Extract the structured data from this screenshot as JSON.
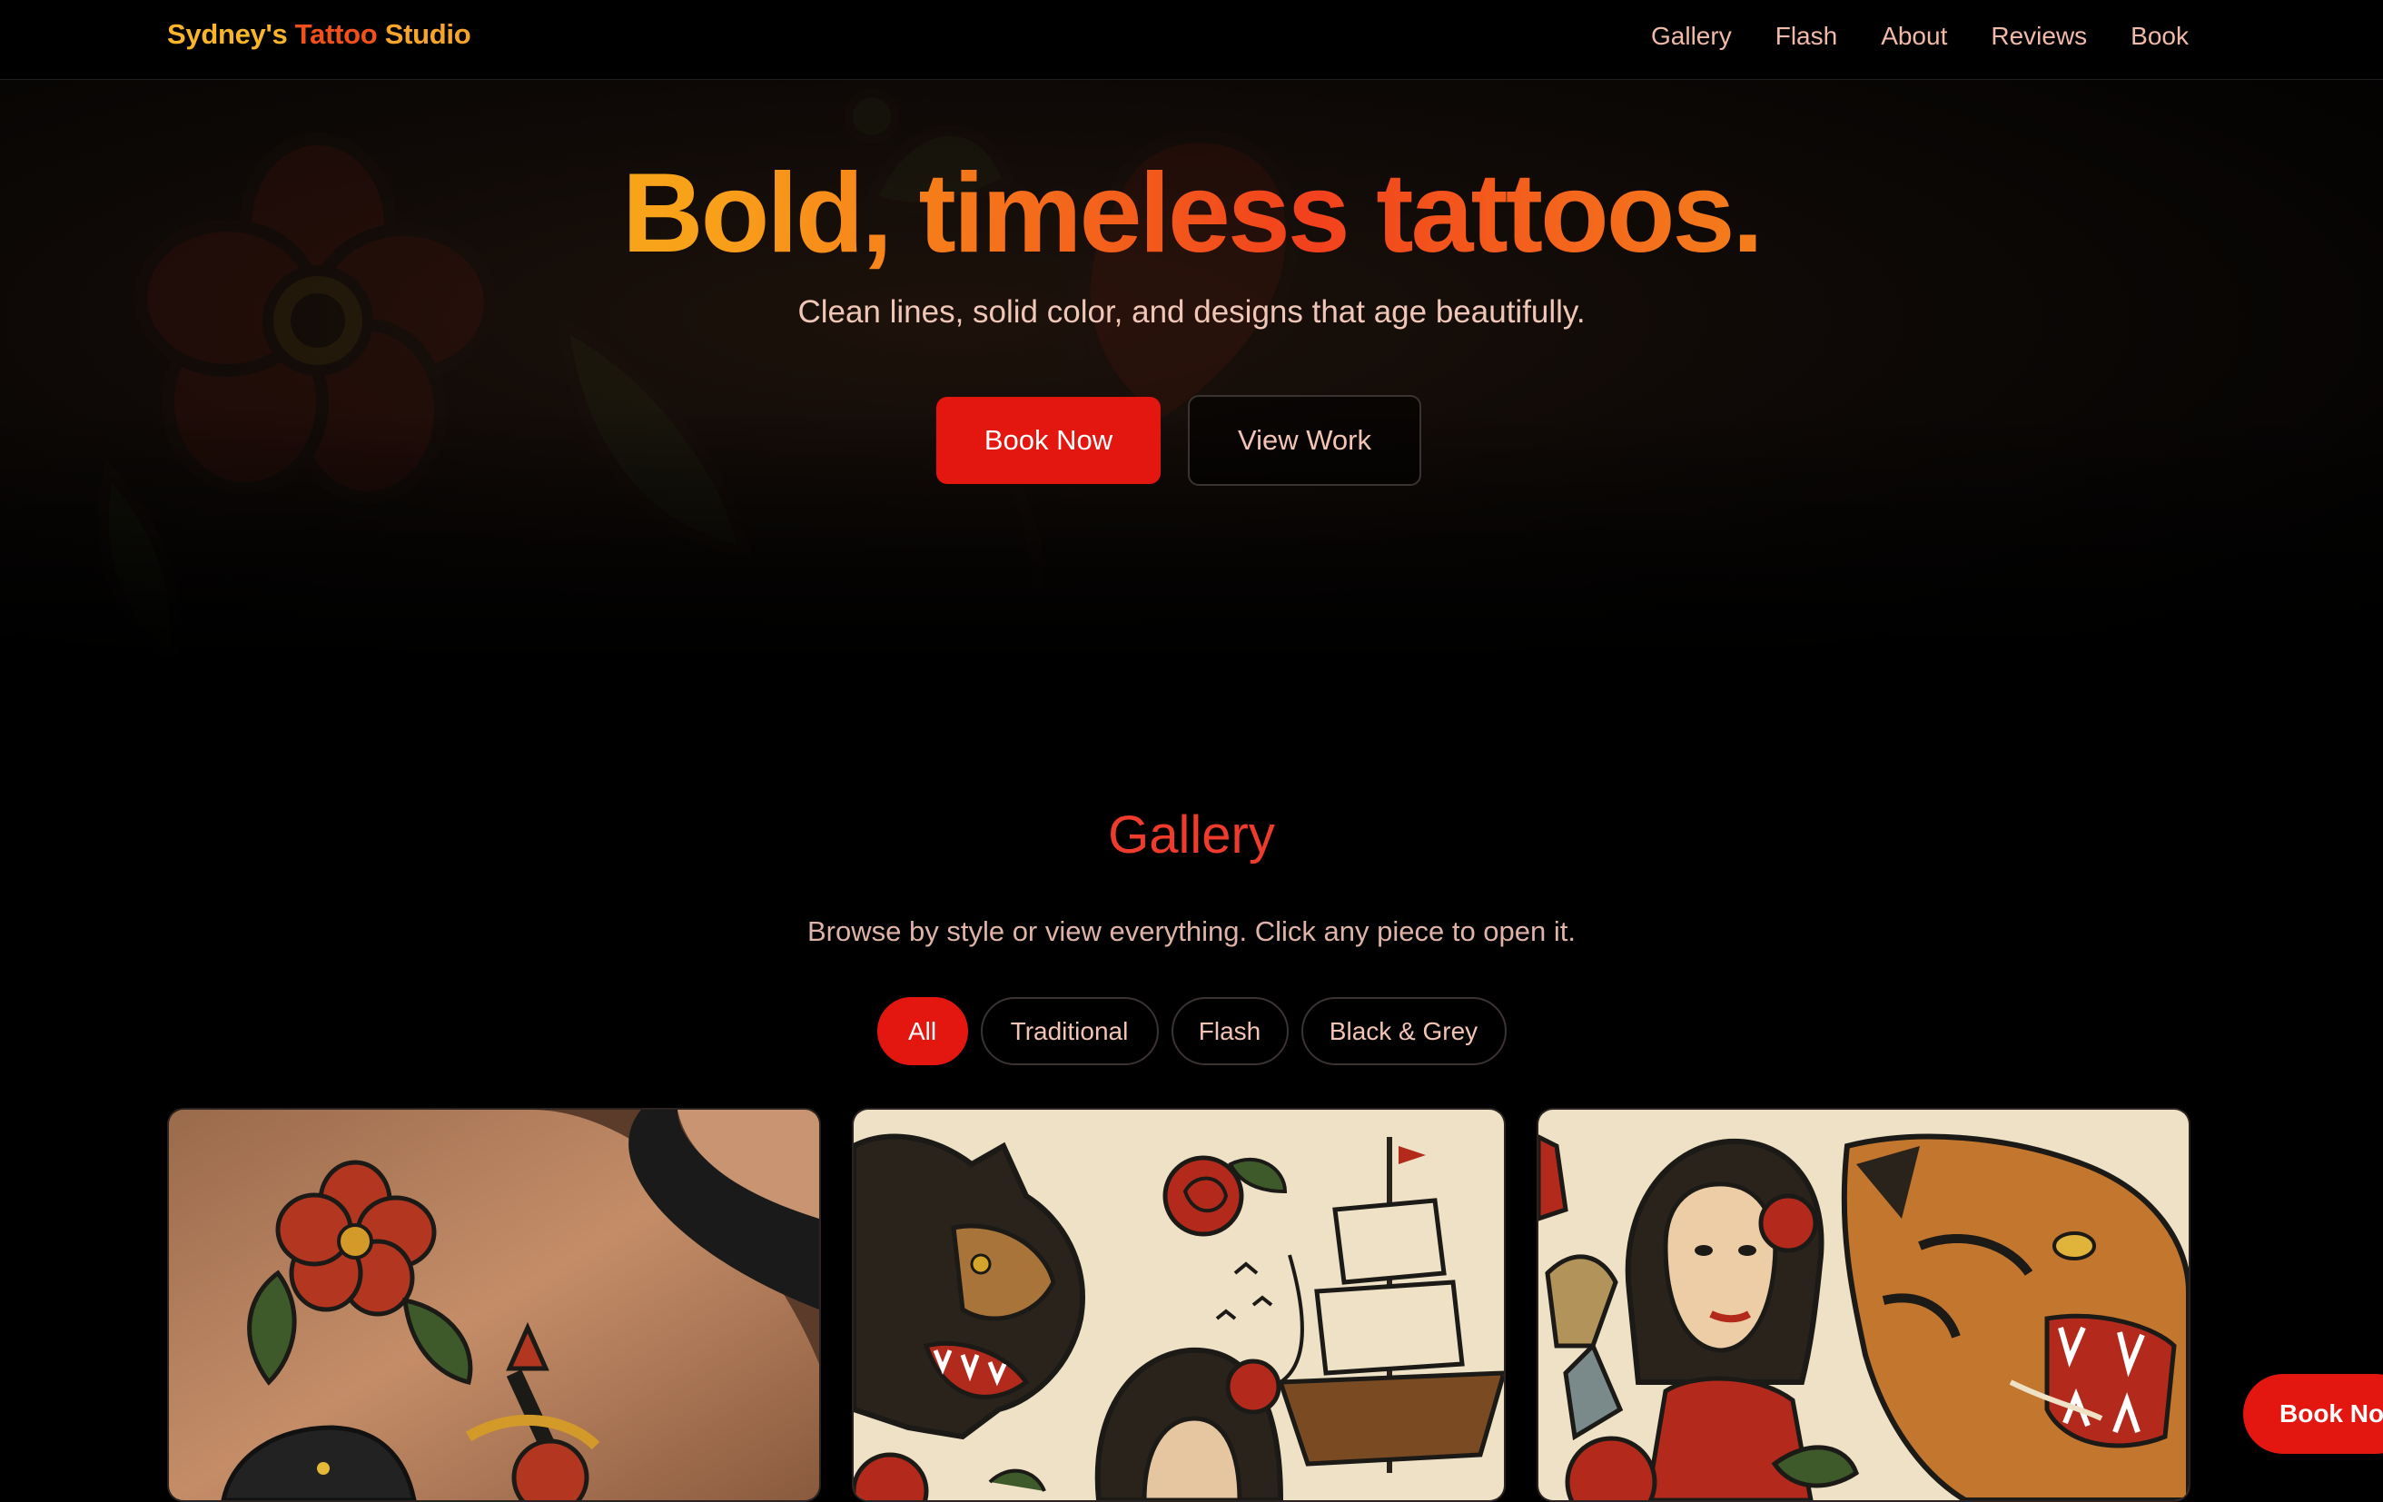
{
  "brand": {
    "part1": "Sydney's ",
    "part2": "Tattoo",
    "part3": " Studio"
  },
  "nav": {
    "items": [
      "Gallery",
      "Flash",
      "About",
      "Reviews",
      "Book"
    ]
  },
  "hero": {
    "title": "Bold, timeless tattoos.",
    "subtitle": "Clean lines, solid color, and designs that age beautifully.",
    "primary_button": "Book Now",
    "secondary_button": "View Work"
  },
  "gallery": {
    "title": "Gallery",
    "subtitle": "Browse by style or view everything. Click any piece to open it.",
    "filters": [
      "All",
      "Traditional",
      "Flash",
      "Black & Grey"
    ],
    "active_filter": "All"
  },
  "floating_button": {
    "label": "Book Now"
  },
  "colors": {
    "accent_red": "#e3170f",
    "title_red": "#ef3b2c",
    "gold": "#f9c41d",
    "orange": "#f35a1b"
  }
}
